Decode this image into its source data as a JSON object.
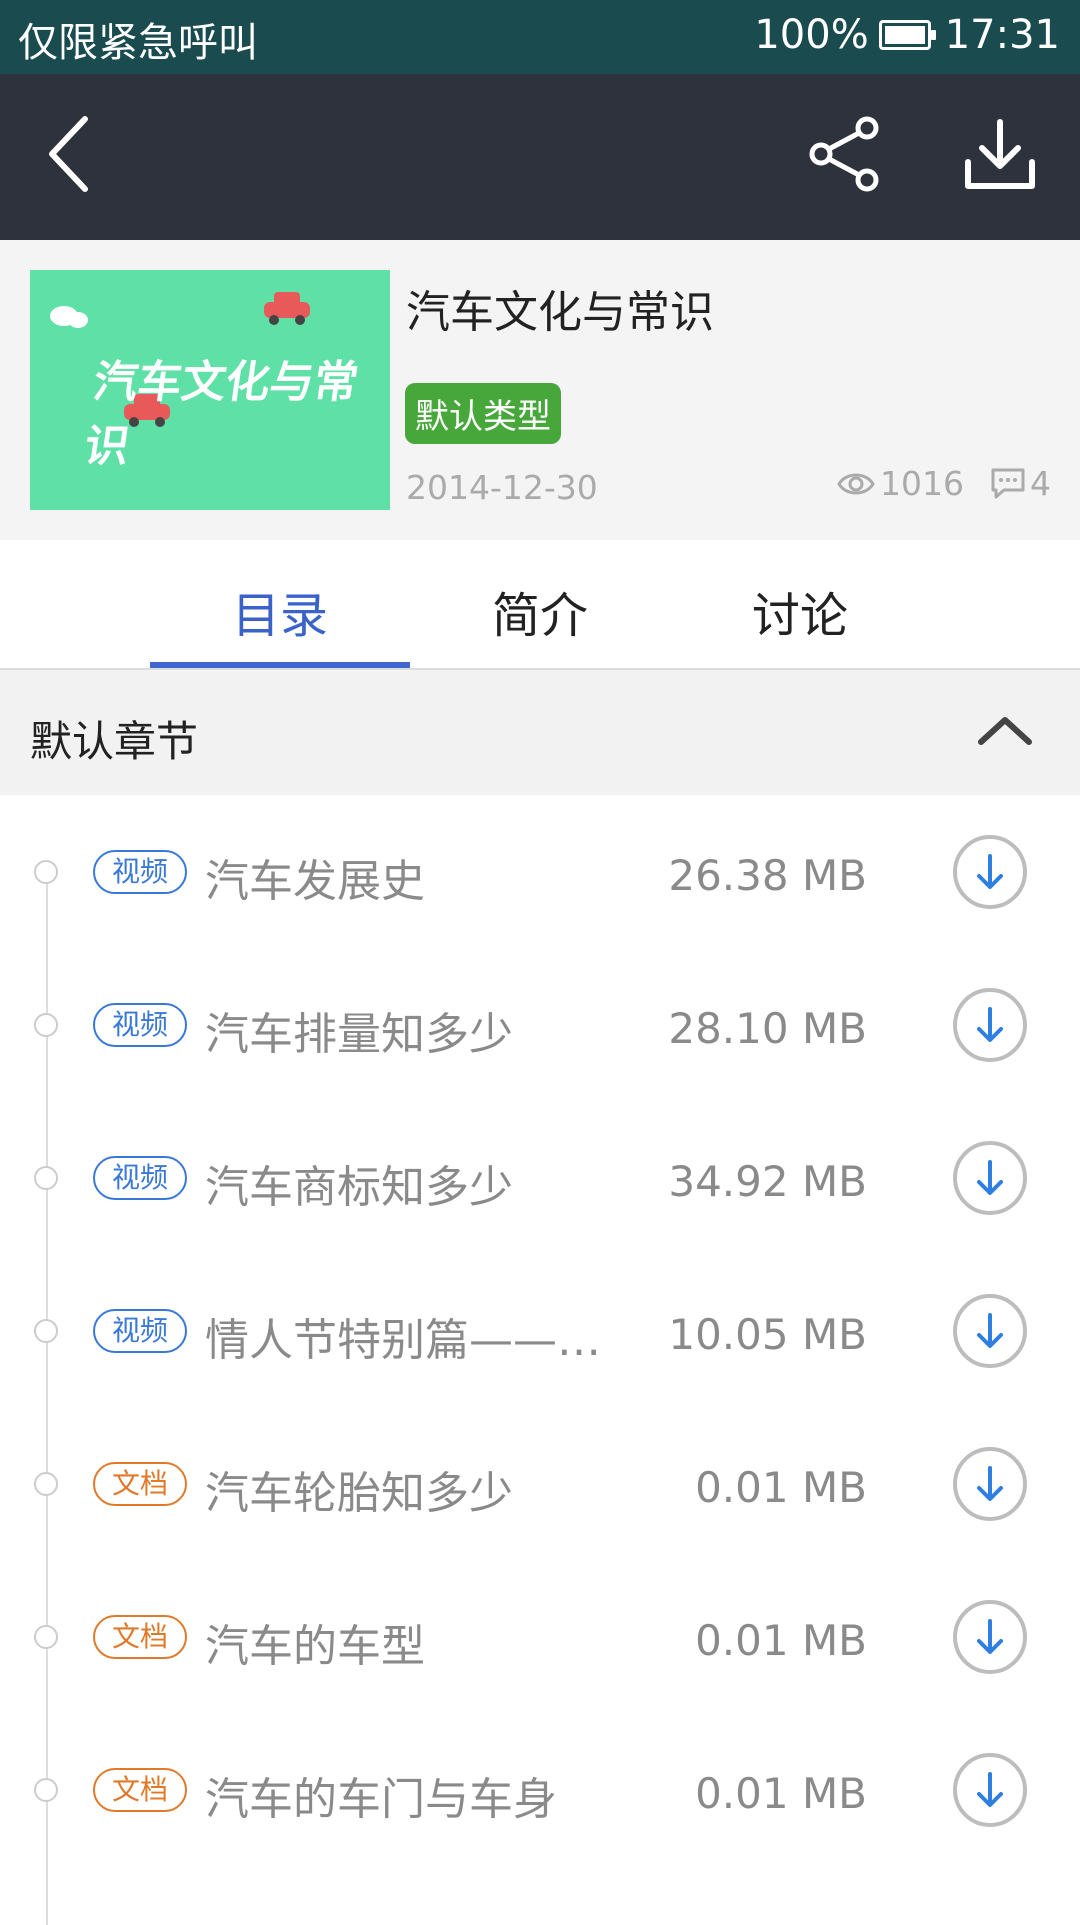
{
  "status_bar": {
    "carrier": "仅限紧急呼叫",
    "battery": "100%",
    "time": "17:31"
  },
  "toolbar": {
    "back_icon": "back-arrow-icon",
    "share_icon": "share-icon",
    "download_icon": "download-icon"
  },
  "course": {
    "cover_text": "汽车文化与常识",
    "title": "汽车文化与常识",
    "type_badge": "默认类型",
    "date": "2014-12-30",
    "views": "1016",
    "comments": "4"
  },
  "tabs": [
    {
      "label": "目录",
      "active": true
    },
    {
      "label": "简介",
      "active": false
    },
    {
      "label": "讨论",
      "active": false
    }
  ],
  "chapter": {
    "title": "默认章节"
  },
  "items": [
    {
      "tag": "视频",
      "tag_type": "video",
      "title": "汽车发展史",
      "size": "26.38 MB"
    },
    {
      "tag": "视频",
      "tag_type": "video",
      "title": "汽车排量知多少",
      "size": "28.10 MB"
    },
    {
      "tag": "视频",
      "tag_type": "video",
      "title": "汽车商标知多少",
      "size": "34.92 MB"
    },
    {
      "tag": "视频",
      "tag_type": "video",
      "title": "情人节特别篇——那...",
      "size": "10.05 MB"
    },
    {
      "tag": "文档",
      "tag_type": "doc",
      "title": "汽车轮胎知多少",
      "size": "0.01 MB"
    },
    {
      "tag": "文档",
      "tag_type": "doc",
      "title": "汽车的车型",
      "size": "0.01 MB"
    },
    {
      "tag": "文档",
      "tag_type": "doc",
      "title": "汽车的车门与车身",
      "size": "0.01 MB"
    }
  ],
  "colors": {
    "accent": "#3a62c9",
    "video": "#3a78d8",
    "doc": "#e07a2a",
    "badge": "#47a73b",
    "toolbar": "#2e323d",
    "status": "#1a4b4f"
  }
}
